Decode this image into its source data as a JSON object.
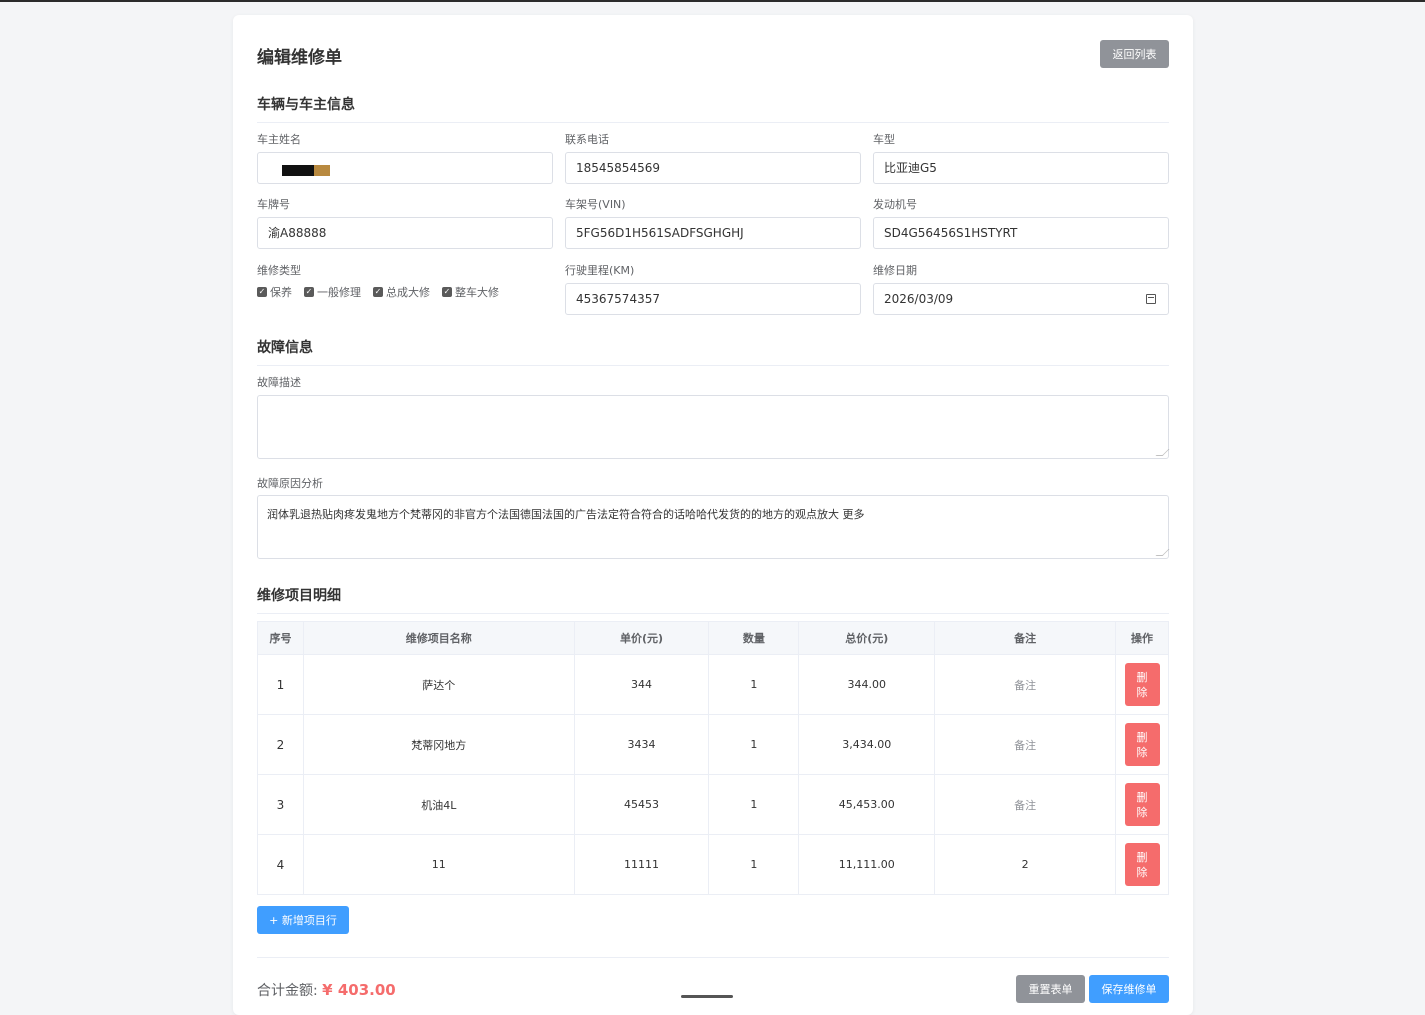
{
  "header": {
    "title": "编辑维修单",
    "back_label": "返回列表"
  },
  "vehicle_section": {
    "title": "车辆与车主信息",
    "owner_name": {
      "label": "车主姓名",
      "value": ""
    },
    "phone": {
      "label": "联系电话",
      "value": "18545854569"
    },
    "model": {
      "label": "车型",
      "value": "比亚迪G5"
    },
    "plate": {
      "label": "车牌号",
      "value": "渝A88888"
    },
    "vin": {
      "label": "车架号(VIN)",
      "value": "5FG56D1H561SADFSGHGHJ"
    },
    "engine": {
      "label": "发动机号",
      "value": "SD4G56456S1HSTYRT"
    },
    "repair_type": {
      "label": "维修类型",
      "options": [
        {
          "label": "保养",
          "checked": true
        },
        {
          "label": "一般修理",
          "checked": true
        },
        {
          "label": "总成大修",
          "checked": true
        },
        {
          "label": "整车大修",
          "checked": true
        }
      ]
    },
    "mileage": {
      "label": "行驶里程(KM)",
      "value": "45367574357"
    },
    "repair_date": {
      "label": "维修日期",
      "value": "2026/03/09"
    }
  },
  "fault_section": {
    "title": "故障信息",
    "description": {
      "label": "故障描述",
      "value": ""
    },
    "cause": {
      "label": "故障原因分析",
      "value": "润体乳退热贴肉疼发鬼地方个梵蒂冈的非官方个法国德国法国的广告法定符合符合的话哈哈代发货的的地方的观点放大 更多"
    }
  },
  "items_section": {
    "title": "维修项目明细",
    "columns": [
      "序号",
      "维修项目名称",
      "单价(元)",
      "数量",
      "总价(元)",
      "备注",
      "操作"
    ],
    "rows": [
      {
        "seq": "1",
        "name": "萨达个",
        "price": "344",
        "qty": "1",
        "total": "344.00",
        "note": "备注"
      },
      {
        "seq": "2",
        "name": "梵蒂冈地方",
        "price": "3434",
        "qty": "1",
        "total": "3,434.00",
        "note": "备注"
      },
      {
        "seq": "3",
        "name": "机油4L",
        "price": "45453",
        "qty": "1",
        "total": "45,453.00",
        "note": "备注"
      },
      {
        "seq": "4",
        "name": "11",
        "price": "11111",
        "qty": "1",
        "total": "11,111.00",
        "note": "2"
      }
    ],
    "delete_label": "删除",
    "add_label": "+ 新增项目行"
  },
  "footer": {
    "total_label": "合计金额:",
    "total_value": "¥ 403.00",
    "reset_label": "重置表单",
    "save_label": "保存维修单"
  },
  "colors": {
    "primary": "#409eff",
    "danger": "#f56c6c",
    "info": "#909399"
  }
}
